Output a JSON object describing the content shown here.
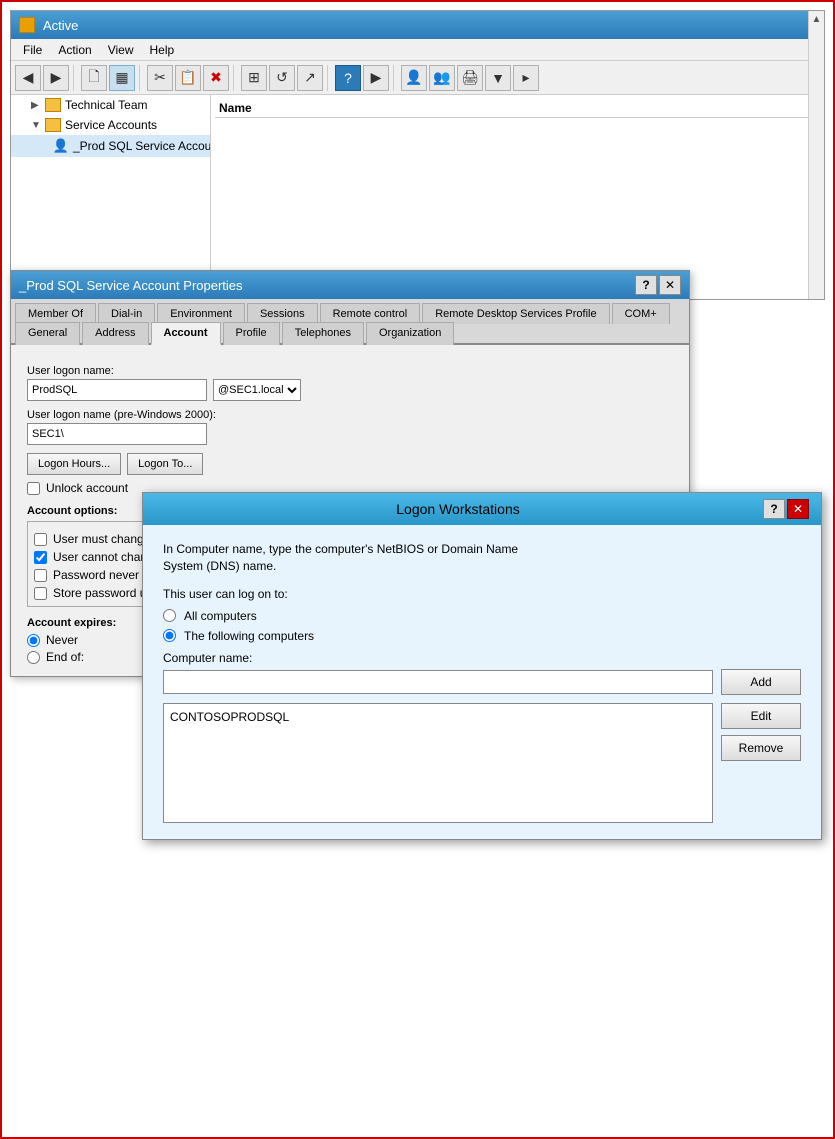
{
  "app": {
    "title": "Active",
    "icon_label": "AD"
  },
  "menubar": {
    "items": [
      "File",
      "Action",
      "View",
      "Help"
    ]
  },
  "toolbar": {
    "buttons": [
      "←",
      "→",
      "📁",
      "▦",
      "✂",
      "📋",
      "✖",
      "⊞",
      "↺",
      "↗",
      "?",
      "▶",
      "👤",
      "👥",
      "🖨",
      "▼",
      "▸"
    ]
  },
  "tree": {
    "items": [
      {
        "label": "Technical Team",
        "type": "folder",
        "indent": 1,
        "expander": "▶"
      },
      {
        "label": "Service Accounts",
        "type": "folder",
        "indent": 1,
        "expander": "▼"
      },
      {
        "label": "_Prod SQL Service Account",
        "type": "user",
        "indent": 2,
        "expander": ""
      }
    ]
  },
  "right_panel": {
    "column_header": "Name"
  },
  "props_dialog": {
    "title": "_Prod SQL Service Account Properties",
    "tabs": [
      {
        "label": "Member Of",
        "active": false
      },
      {
        "label": "Dial-in",
        "active": false
      },
      {
        "label": "Environment",
        "active": false
      },
      {
        "label": "Sessions",
        "active": false
      },
      {
        "label": "Remote control",
        "active": false
      },
      {
        "label": "Remote Desktop Services Profile",
        "active": false
      },
      {
        "label": "COM+",
        "active": false
      },
      {
        "label": "General",
        "active": false
      },
      {
        "label": "Address",
        "active": false
      },
      {
        "label": "Account",
        "active": true
      },
      {
        "label": "Profile",
        "active": false
      },
      {
        "label": "Telephones",
        "active": false
      },
      {
        "label": "Organization",
        "active": false
      }
    ],
    "fields": {
      "user_logon_name_label": "User logon name:",
      "user_logon_value": "ProdSQL",
      "user_logon_pre2000_label": "User logon name (pre-Windows 2000):",
      "user_logon_pre2000_value": "SEC1\\",
      "logon_hours_btn": "Logon Hours...",
      "logon_workstations_btn": "Logon To...",
      "unlock_checkbox_label": "Unlock account",
      "account_options_label": "Account options:",
      "account_options": [
        {
          "label": "User must change password at next logon",
          "checked": false
        },
        {
          "label": "User cannot change password",
          "checked": true
        },
        {
          "label": "Password never expires",
          "checked": false
        },
        {
          "label": "Store password using reversible encryption",
          "checked": false
        }
      ],
      "account_expires_label": "Account expires:",
      "never_radio": "Never",
      "end_of_radio": "End of:"
    }
  },
  "logon_dialog": {
    "title": "Logon Workstations",
    "description_line1": "In Computer name, type the computer's NetBIOS or Domain Name",
    "description_line2": "System (DNS) name.",
    "logon_section_label": "This user can log on to:",
    "radio_all": "All computers",
    "radio_following": "The following computers",
    "computer_name_label": "Computer name:",
    "computer_name_value": "",
    "add_btn": "Add",
    "edit_btn": "Edit",
    "remove_btn": "Remove",
    "list_items": [
      "CONTOSOPRODSQL"
    ],
    "help_btn": "?",
    "close_btn": "X"
  }
}
